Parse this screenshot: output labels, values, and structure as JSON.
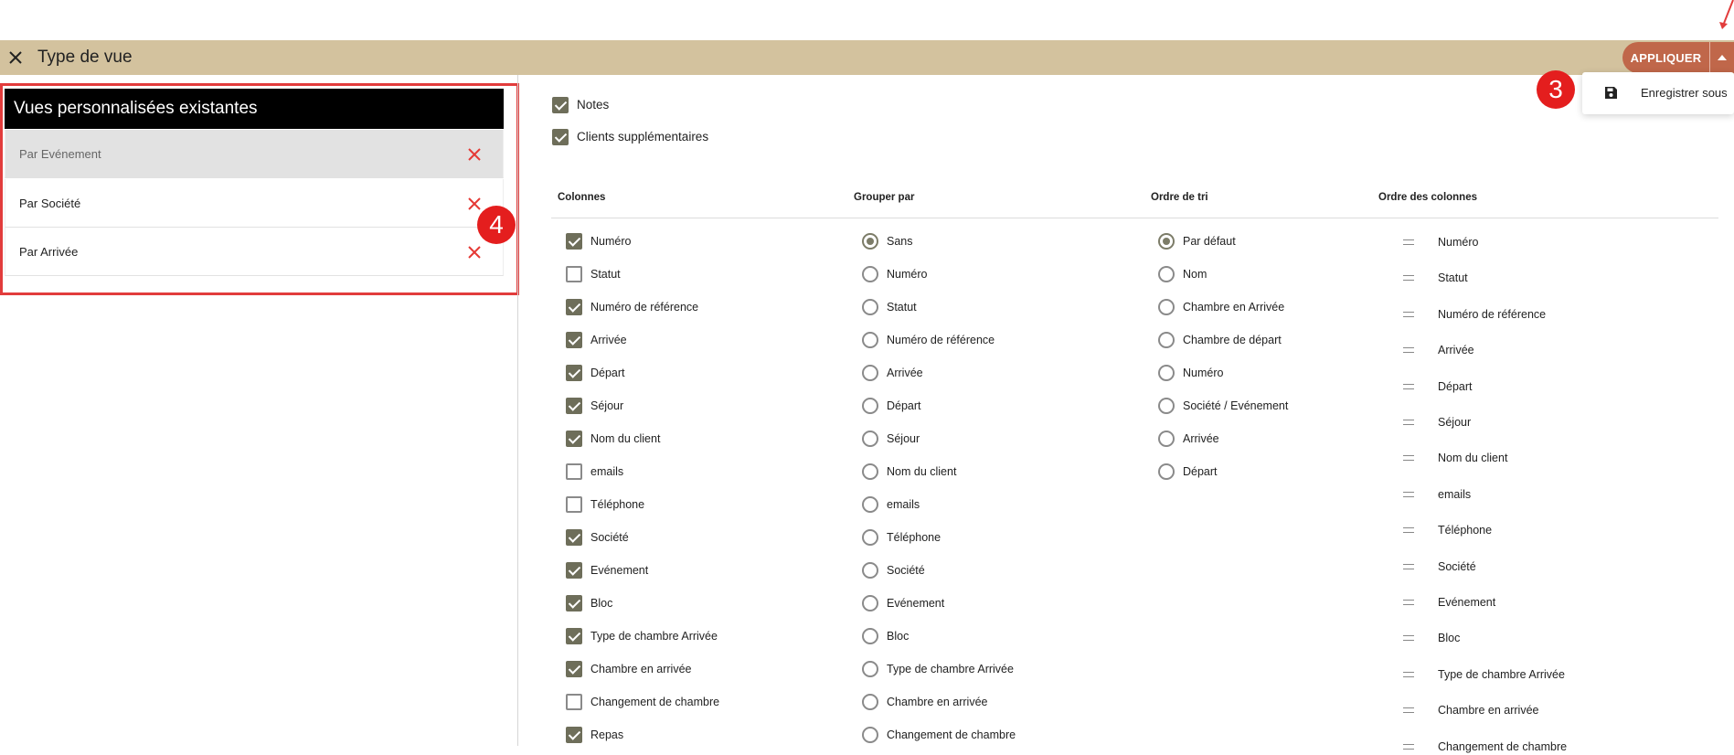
{
  "header": {
    "title": "Type de vue",
    "apply_label": "APPLIQUER"
  },
  "dropdown": {
    "save_as_label": "Enregistrer sous"
  },
  "annotations": {
    "badge_3": "3",
    "badge_4": "4"
  },
  "left_panel": {
    "title": "Vues personnalisées existantes",
    "views": [
      {
        "label": "Par Evénement",
        "selected": true
      },
      {
        "label": "Par Société",
        "selected": false
      },
      {
        "label": "Par Arrivée",
        "selected": false
      }
    ]
  },
  "options": {
    "notes": {
      "label": "Notes",
      "checked": true
    },
    "extra_clients": {
      "label": "Clients supplémentaires",
      "checked": true
    }
  },
  "columns_header": "Colonnes",
  "group_header": "Grouper par",
  "sort_header": "Ordre de tri",
  "order_header": "Ordre des colonnes",
  "columns": [
    {
      "label": "Numéro",
      "checked": true
    },
    {
      "label": "Statut",
      "checked": false
    },
    {
      "label": "Numéro de référence",
      "checked": true
    },
    {
      "label": "Arrivée",
      "checked": true
    },
    {
      "label": "Départ",
      "checked": true
    },
    {
      "label": "Séjour",
      "checked": true
    },
    {
      "label": "Nom du client",
      "checked": true
    },
    {
      "label": "emails",
      "checked": false
    },
    {
      "label": "Téléphone",
      "checked": false
    },
    {
      "label": "Société",
      "checked": true
    },
    {
      "label": "Evénement",
      "checked": true
    },
    {
      "label": "Bloc",
      "checked": true
    },
    {
      "label": "Type de chambre Arrivée",
      "checked": true
    },
    {
      "label": "Chambre en arrivée",
      "checked": true
    },
    {
      "label": "Changement de chambre",
      "checked": false
    },
    {
      "label": "Repas",
      "checked": true
    }
  ],
  "group_by": [
    {
      "label": "Sans",
      "selected": true
    },
    {
      "label": "Numéro",
      "selected": false
    },
    {
      "label": "Statut",
      "selected": false
    },
    {
      "label": "Numéro de référence",
      "selected": false
    },
    {
      "label": "Arrivée",
      "selected": false
    },
    {
      "label": "Départ",
      "selected": false
    },
    {
      "label": "Séjour",
      "selected": false
    },
    {
      "label": "Nom du client",
      "selected": false
    },
    {
      "label": "emails",
      "selected": false
    },
    {
      "label": "Téléphone",
      "selected": false
    },
    {
      "label": "Société",
      "selected": false
    },
    {
      "label": "Evénement",
      "selected": false
    },
    {
      "label": "Bloc",
      "selected": false
    },
    {
      "label": "Type de chambre Arrivée",
      "selected": false
    },
    {
      "label": "Chambre en arrivée",
      "selected": false
    },
    {
      "label": "Changement de chambre",
      "selected": false
    }
  ],
  "sort_order": [
    {
      "label": "Par défaut",
      "selected": true
    },
    {
      "label": "Nom",
      "selected": false
    },
    {
      "label": "Chambre en Arrivée",
      "selected": false
    },
    {
      "label": "Chambre de départ",
      "selected": false
    },
    {
      "label": "Numéro",
      "selected": false
    },
    {
      "label": "Société / Evénement",
      "selected": false
    },
    {
      "label": "Arrivée",
      "selected": false
    },
    {
      "label": "Départ",
      "selected": false
    }
  ],
  "column_order": [
    "Numéro",
    "Statut",
    "Numéro de référence",
    "Arrivée",
    "Départ",
    "Séjour",
    "Nom du client",
    "emails",
    "Téléphone",
    "Société",
    "Evénement",
    "Bloc",
    "Type de chambre Arrivée",
    "Chambre en arrivée",
    "Changement de chambre"
  ],
  "colors": {
    "header_bg": "#d3c29e",
    "accent": "#c0674a",
    "annotation_red": "#e41e1e",
    "check": "#6e6e5a"
  }
}
